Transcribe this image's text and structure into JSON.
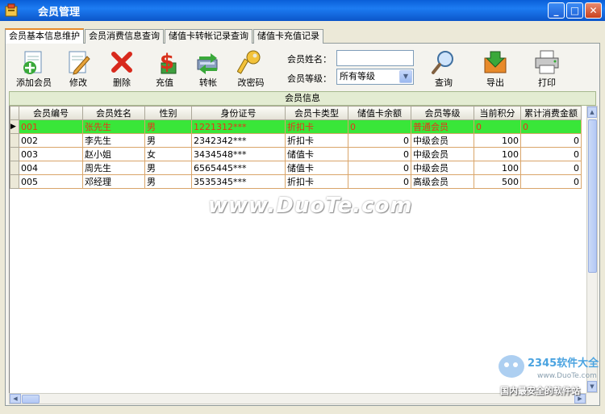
{
  "window": {
    "title": "会员管理"
  },
  "tabs": [
    "会员基本信息维护",
    "会员消费信息查询",
    "储值卡转帐记录查询",
    "储值卡充值记录"
  ],
  "toolbar": {
    "add": "添加会员",
    "edit": "修改",
    "delete": "删除",
    "recharge": "充值",
    "transfer": "转帐",
    "password": "改密码",
    "query": "查询",
    "export": "导出",
    "print": "打印"
  },
  "search": {
    "name_label": "会员姓名：",
    "name_value": "",
    "level_label": "会员等级：",
    "level_value": "所有等级"
  },
  "grid": {
    "caption": "会员信息",
    "columns": [
      "会员编号",
      "会员姓名",
      "性别",
      "身份证号",
      "会员卡类型",
      "储值卡余额",
      "会员等级",
      "当前积分",
      "累计消费金额"
    ],
    "rows": [
      [
        "001",
        "张先生",
        "男",
        "1221312***",
        "折扣卡",
        "0",
        "普通会员",
        "0",
        "0"
      ],
      [
        "002",
        "李先生",
        "男",
        "2342342***",
        "折扣卡",
        "0",
        "中级会员",
        "100",
        "0"
      ],
      [
        "003",
        "赵小姐",
        "女",
        "3434548***",
        "储值卡",
        "0",
        "中级会员",
        "100",
        "0"
      ],
      [
        "004",
        "周先生",
        "男",
        "6565445***",
        "储值卡",
        "0",
        "中级会员",
        "100",
        "0"
      ],
      [
        "005",
        "邓经理",
        "男",
        "3535345***",
        "折扣卡",
        "0",
        "高级会员",
        "500",
        "0"
      ]
    ]
  },
  "watermarks": {
    "duote": "www.DuoTe.com",
    "logo_brand": "2345软件大全",
    "logo_url": "www.DuoTe.com",
    "logo_slogan": "国内最安全的软件站"
  },
  "colors": {
    "selected_row": "#39e639",
    "selected_text": "#e8311b",
    "title_bar": "#0a5fd8"
  }
}
